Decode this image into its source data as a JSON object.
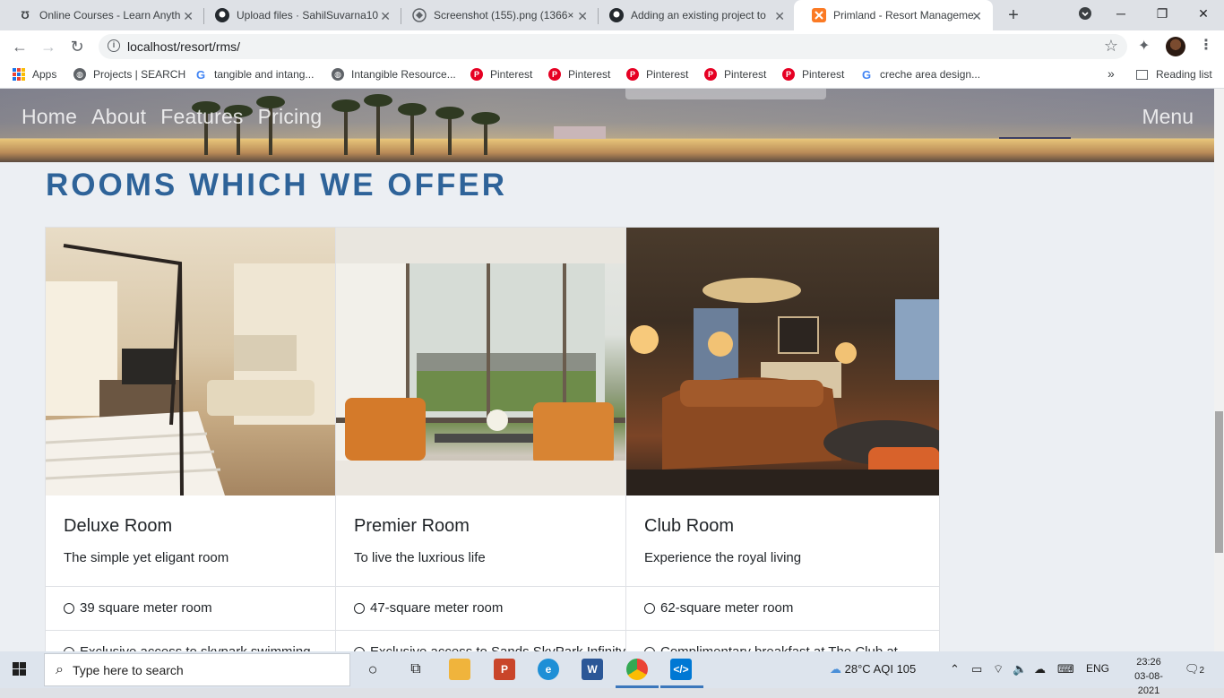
{
  "browser": {
    "tabs": [
      {
        "title": "Online Courses - Learn Anyth",
        "icon": "udemy-icon"
      },
      {
        "title": "Upload files · SahilSuvarna10",
        "icon": "github-icon"
      },
      {
        "title": "Screenshot (155).png (1366×",
        "icon": "web-icon"
      },
      {
        "title": "Adding an existing project to",
        "icon": "github-icon"
      },
      {
        "title": "Primland - Resort Manageme",
        "icon": "xampp-icon"
      }
    ],
    "url": "localhost/resort/rms/",
    "bookmarks": [
      {
        "label": "Apps"
      },
      {
        "label": "Projects | SEARCH"
      },
      {
        "label": "tangible and intang..."
      },
      {
        "label": "Intangible Resource..."
      },
      {
        "label": "Pinterest"
      },
      {
        "label": "Pinterest"
      },
      {
        "label": "Pinterest"
      },
      {
        "label": "Pinterest"
      },
      {
        "label": "Pinterest"
      },
      {
        "label": "creche area design..."
      }
    ],
    "overflow": "»",
    "reading_list": "Reading list"
  },
  "page": {
    "nav": [
      "Home",
      "About",
      "Features",
      "Pricing"
    ],
    "menu": "Menu",
    "section_title": "ROOMS WHICH WE OFFER",
    "rooms": [
      {
        "name": "Deluxe Room",
        "desc": "The simple yet eligant room",
        "features": [
          "39 square meter room",
          "Exclusive access to skypark swimming"
        ]
      },
      {
        "name": "Premier Room",
        "desc": "To live the luxrious life",
        "features": [
          "47-square meter room",
          "Exclusive access to Sands SkyPark Infinity"
        ]
      },
      {
        "name": "Club Room",
        "desc": "Experience the royal living",
        "features": [
          "62-square meter room",
          "Complimentary breakfast at The Club at"
        ]
      }
    ]
  },
  "taskbar": {
    "search_placeholder": "Type here to search",
    "weather": "28°C  AQI 105",
    "lang": "ENG",
    "time": "23:26",
    "date": "03-08-2021",
    "notifications": "2"
  }
}
